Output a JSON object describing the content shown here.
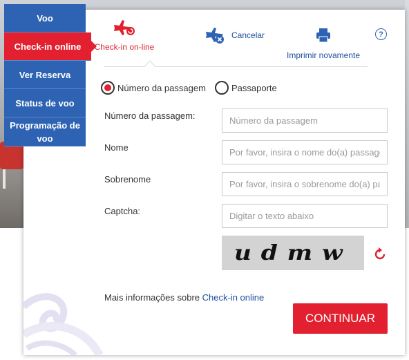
{
  "nav": {
    "items": [
      {
        "label": "Voo"
      },
      {
        "label": "Check-in online"
      },
      {
        "label": "Ver Reserva"
      },
      {
        "label": "Status de voo"
      },
      {
        "label": "Programação de voo"
      }
    ],
    "active_color": "#e2202f",
    "color": "#2e63b3"
  },
  "tabs": {
    "checkin": {
      "label": "Check-in on-line",
      "icon": "plane-checkin-icon"
    },
    "cancel": {
      "label": "Cancelar",
      "icon": "plane-cancel-icon"
    },
    "print": {
      "label": "Imprimir novamente",
      "icon": "printer-icon"
    },
    "help": {
      "label": "?"
    }
  },
  "search_type": {
    "options": [
      {
        "label": "Número da passagem",
        "selected": true
      },
      {
        "label": "Passaporte",
        "selected": false
      }
    ]
  },
  "form": {
    "ticket": {
      "label": "Número da passagem:",
      "placeholder": "Número da passagem",
      "value": ""
    },
    "first_name": {
      "label": "Nome",
      "placeholder": "Por favor, insira o nome do(a) passageiro",
      "value": ""
    },
    "last_name": {
      "label": "Sobrenome",
      "placeholder": "Por favor, insira o sobrenome do(a) passageiro",
      "value": ""
    },
    "captcha": {
      "label": "Captcha:",
      "placeholder": "Digitar o texto abaixo",
      "value": "",
      "image_text": "udmw"
    }
  },
  "footer": {
    "more_info_prefix": "Mais informações sobre",
    "more_info_link": "Check-in online",
    "continue_label": "CONTINUAR"
  }
}
